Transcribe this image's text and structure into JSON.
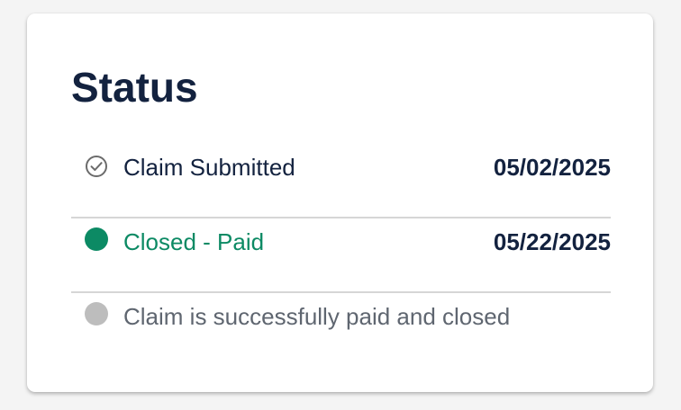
{
  "status_card": {
    "title": "Status",
    "steps": [
      {
        "label": "Claim Submitted",
        "date": "05/02/2025",
        "icon": "check-circle-icon",
        "state": "completed",
        "label_color": "#13223f",
        "icon_color": "#6b6b6b"
      },
      {
        "label": "Closed - Paid",
        "date": "05/22/2025",
        "icon": "green-dot-icon",
        "state": "current",
        "label_color": "#0c8a64",
        "icon_color": "#0c8a64"
      },
      {
        "label": "Claim is successfully paid and closed",
        "icon": "gray-dot-icon",
        "state": "upcoming",
        "label_color": "#5f6670",
        "icon_color": "#bdbdbd"
      }
    ]
  },
  "colors": {
    "background": "#f4f4f4",
    "card": "#ffffff",
    "heading": "#13223f",
    "accent_green": "#0c8a64",
    "divider": "#d6d6d6"
  }
}
